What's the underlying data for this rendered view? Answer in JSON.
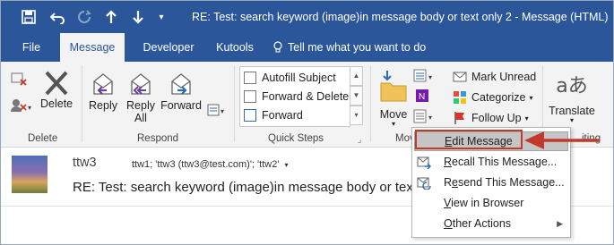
{
  "window": {
    "title": "RE: Test: search keyword (image)in message body or text only 2  -  Message (HTML)"
  },
  "qat": {
    "save_icon": "save-icon",
    "undo_icon": "undo-icon",
    "redo_icon": "redo-icon",
    "up_icon": "arrow-up-icon",
    "down_icon": "arrow-down-icon",
    "customize_icon": "chevron-down-icon"
  },
  "tabs": [
    {
      "label": "File"
    },
    {
      "label": "Message"
    },
    {
      "label": "Developer"
    },
    {
      "label": "Kutools"
    },
    {
      "label": "Tell me what you want to do"
    }
  ],
  "ribbon": {
    "delete_group": {
      "label": "Delete",
      "delete_btn": "Delete"
    },
    "respond_group": {
      "label": "Respond",
      "reply": "Reply",
      "reply_all_1": "Reply",
      "reply_all_2": "All",
      "forward": "Forward"
    },
    "quick_steps": {
      "label": "Quick Steps",
      "items": [
        {
          "label": "Autofill Subject"
        },
        {
          "label": "Forward & Delete"
        },
        {
          "label": "Forward"
        }
      ]
    },
    "move_group": {
      "label": "Mov",
      "move_btn": "Move"
    },
    "tags": {
      "mark_unread": "Mark Unread",
      "categorize": "Categorize",
      "follow_up": "Follow Up"
    },
    "translate": {
      "label": "Translate",
      "group_label": "iting"
    }
  },
  "message": {
    "sender": "ttw3",
    "recipients": "ttw1; 'ttw3 (ttw3@test.com)'; 'ttw2'",
    "subject": "RE: Test: search keyword (image)in message body or tex"
  },
  "dropdown": {
    "items": [
      {
        "pre": "",
        "ul": "E",
        "post": "dit Message"
      },
      {
        "pre": "",
        "ul": "R",
        "post": "ecall This Message..."
      },
      {
        "pre": "R",
        "ul": "e",
        "post": "send This Message..."
      },
      {
        "pre": "",
        "ul": "V",
        "post": "iew in Browser"
      },
      {
        "pre": "",
        "ul": "O",
        "post": "ther Actions"
      }
    ]
  },
  "colors": {
    "title_bar": "#2b579a",
    "ribbon": "#f3f3f3",
    "highlight": "#c0392b"
  }
}
